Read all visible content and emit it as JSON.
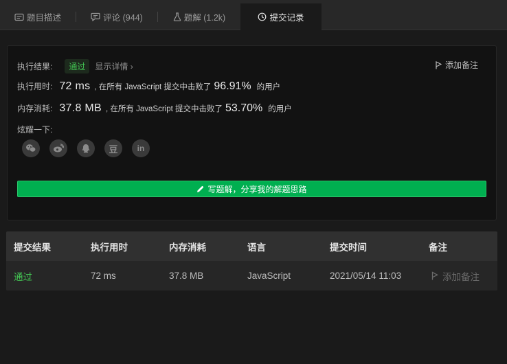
{
  "tabs": [
    {
      "label": "题目描述",
      "icon": "description-icon"
    },
    {
      "label": "评论 (944)",
      "icon": "comment-icon"
    },
    {
      "label": "题解 (1.2k)",
      "icon": "flask-icon"
    },
    {
      "label": "提交记录",
      "icon": "clock-icon"
    }
  ],
  "result": {
    "label": "执行结果:",
    "status": "通过",
    "detail_link": "显示详情 ›",
    "add_note": "添加备注"
  },
  "runtime": {
    "label": "执行用时:",
    "value": "72 ms",
    "mid_text": ", 在所有 JavaScript 提交中击败了",
    "percent": "96.91%",
    "suffix": "的用户"
  },
  "memory": {
    "label": "内存消耗:",
    "value": "37.8 MB",
    "mid_text": ", 在所有 JavaScript 提交中击败了",
    "percent": "53.70%",
    "suffix": "的用户"
  },
  "share": {
    "label": "炫耀一下:",
    "icons": [
      "wechat-icon",
      "weibo-icon",
      "qq-icon",
      "douban-icon",
      "linkedin-icon"
    ],
    "douban_glyph": "豆",
    "linkedin_glyph": "in"
  },
  "write_solution_button": "写题解，分享我的解题思路",
  "table": {
    "headers": [
      "提交结果",
      "执行用时",
      "内存消耗",
      "语言",
      "提交时间",
      "备注"
    ],
    "rows": [
      {
        "result": "通过",
        "runtime": "72 ms",
        "memory": "37.8 MB",
        "language": "JavaScript",
        "time": "2021/05/14 11:03",
        "note": "添加备注"
      }
    ]
  },
  "colors": {
    "accent_green": "#00af50",
    "pass_green": "#43c553",
    "background": "#1a1a1a"
  }
}
